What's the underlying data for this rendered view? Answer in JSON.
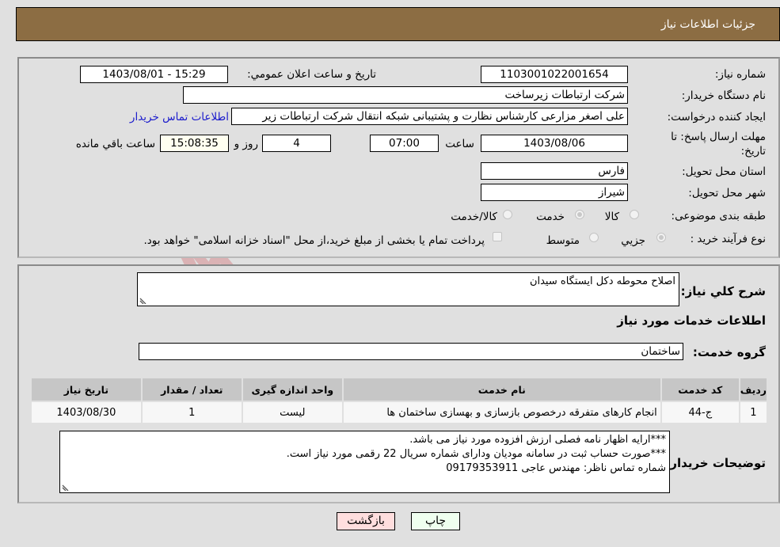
{
  "header": {
    "title": "جزئيات اطلاعات نیاز"
  },
  "watermark": {
    "text": "AriaTender.neT"
  },
  "form": {
    "need_number": {
      "label": "شماره نیاز:",
      "value": "1103001022001654"
    },
    "announce_datetime": {
      "label": "تاريخ و ساعت اعلان عمومي:",
      "value": "1403/08/01 - 15:29"
    },
    "buyer_org": {
      "label": "نام دستگاه خریدار:",
      "value": "شرکت ارتباطات زیرساخت"
    },
    "requester": {
      "label": "ایجاد کننده درخواست:",
      "value": "علی اصغر مزارعی کارشناس نظارت و پشتیبانی شبکه انتقال شرکت ارتباطات زیر",
      "contact_link": "اطلاعات تماس خریدار"
    },
    "deadline": {
      "label": "مهلت ارسال پاسخ: تا تاریخ:",
      "date": "1403/08/06",
      "time_label": "ساعت",
      "time": "07:00",
      "days": "4",
      "days_label": "روز و",
      "remaining": "15:08:35",
      "remaining_label": "ساعت باقي مانده"
    },
    "province": {
      "label": "استان محل تحویل:",
      "value": "فارس"
    },
    "city": {
      "label": "شهر محل تحویل:",
      "value": "شیراز"
    },
    "category": {
      "label": "طبقه بندی موضوعی:",
      "options": [
        {
          "label": "کالا",
          "checked": false
        },
        {
          "label": "خدمت",
          "checked": true
        },
        {
          "label": "کالا/خدمت",
          "checked": false
        }
      ]
    },
    "purchase_type": {
      "label": "نوع فرآیند خرید :",
      "options": [
        {
          "label": "جزيي",
          "checked": true
        },
        {
          "label": "متوسط",
          "checked": false
        }
      ],
      "treasury_checkbox_label": "پرداخت تمام یا بخشی از مبلغ خرید،از محل \"اسناد خزانه اسلامی\" خواهد بود.",
      "treasury_checked": false
    }
  },
  "details": {
    "description_label": "شرح کلي نياز:",
    "description": "اصلاح محوطه دکل ایستگاه سیدان",
    "services_title": "اطلاعات خدمات مورد نياز",
    "service_group_label": "گروه خدمت:",
    "service_group": "ساختمان",
    "table": {
      "headers": [
        "رديف",
        "کد خدمت",
        "نام خدمت",
        "واحد اندازه گيری",
        "تعداد / مقدار",
        "تاريخ نياز"
      ],
      "rows": [
        [
          "1",
          "ج-44",
          "انجام کارهای متفرقه درخصوص بازسازی و بهسازی ساختمان ها",
          "لیست",
          "1",
          "1403/08/30"
        ]
      ]
    },
    "buyer_notes_label": "توضيحات خريدار:",
    "buyer_notes": [
      "***ارایه اظهار نامه فصلی ارزش افزوده مورد نیاز می باشد.",
      "***صورت حساب ثبت در سامانه مودیان ودارای شماره سریال 22 رقمی مورد نیاز است.",
      "شماره تماس ناظر: مهندس عاجی 09179353911"
    ]
  },
  "buttons": {
    "print": "چاپ",
    "back": "بازگشت"
  },
  "colors": {
    "header_bg": "#8c6d43",
    "print_bg": "#efffef",
    "back_bg": "#ffdede",
    "link": "#1a1acc"
  }
}
